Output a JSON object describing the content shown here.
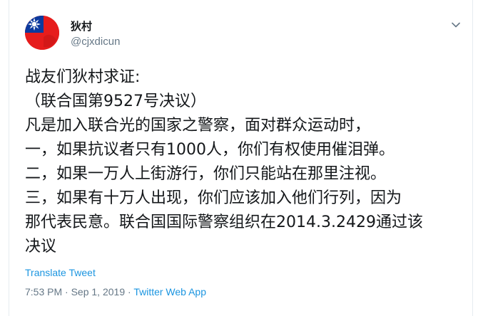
{
  "tweet": {
    "display_name": "狄村",
    "handle": "@cjxdicun",
    "avatar_icon": "taiwan-flag-avatar",
    "menu_icon": "chevron-down-icon",
    "lines": [
      "战友们狄村求证:",
      "（联合国第9527号决议）",
      "凡是加入联合光的国家之警察，面对群众运动时，",
      "一，如果抗议者只有1000人，你们有权使用催泪弹。",
      "二，如果一万人上街游行，你们只能站在那里注视。",
      "三，如果有十万人出现，你们应该加入他们行列，因为",
      "那代表民意。联合国国际警察组织在2014.3.2429通过该",
      "决议"
    ],
    "translate_label": "Translate Tweet",
    "time": "7:53 PM",
    "separator1": " · ",
    "date": "Sep 1, 2019",
    "separator2": " · ",
    "source": "Twitter Web App"
  },
  "colors": {
    "link": "#1b95e0",
    "secondary_text": "#657786",
    "primary_text": "#14171a",
    "flag_red": "#e61c1c",
    "flag_blue": "#0b3a9e"
  }
}
